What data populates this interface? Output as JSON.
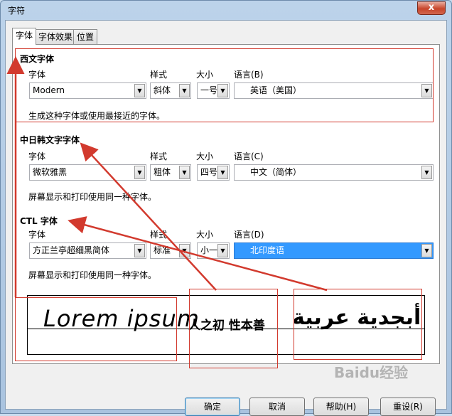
{
  "window": {
    "title": "字符",
    "close_glyph": "x"
  },
  "tabs": [
    {
      "label": "字体",
      "active": true
    },
    {
      "label": "字体效果",
      "active": false
    },
    {
      "label": "位置",
      "active": false
    }
  ],
  "western": {
    "title": "西文字体",
    "font_label": "字体",
    "style_label": "样式",
    "size_label": "大小",
    "lang_label": "语言(B)",
    "font_value": "Modern",
    "style_value": "斜体",
    "size_value": "一号",
    "lang_value": "英语（美国）",
    "hint": "生成这种字体或使用最接近的字体。"
  },
  "asian": {
    "title": "中日韩文字字体",
    "font_label": "字体",
    "style_label": "样式",
    "size_label": "大小",
    "lang_label": "语言(C)",
    "font_value": "微软雅黑",
    "style_value": "粗体",
    "size_value": "四号",
    "lang_value": "中文（简体）",
    "hint": "屏幕显示和打印使用同一种字体。"
  },
  "ctl": {
    "title": "CTL 字体",
    "font_label": "字体",
    "style_label": "样式",
    "size_label": "大小",
    "lang_label": "语言(D)",
    "font_value": "方正兰亭超细黑简体",
    "style_value": "标准",
    "size_value": "小一",
    "lang_value": "北印度语",
    "hint": "屏幕显示和打印使用同一种字体。"
  },
  "preview": {
    "latin": "Lorem ipsum",
    "cjk": "人之初 性本善",
    "arabic": "أبجدية عربية"
  },
  "buttons": {
    "ok": "确定",
    "cancel": "取消",
    "help": "帮助(H)",
    "reset": "重设(R)"
  },
  "watermark": "Baidu经验",
  "colors": {
    "annotation": "#d23a2e",
    "selection": "#3399ff"
  }
}
